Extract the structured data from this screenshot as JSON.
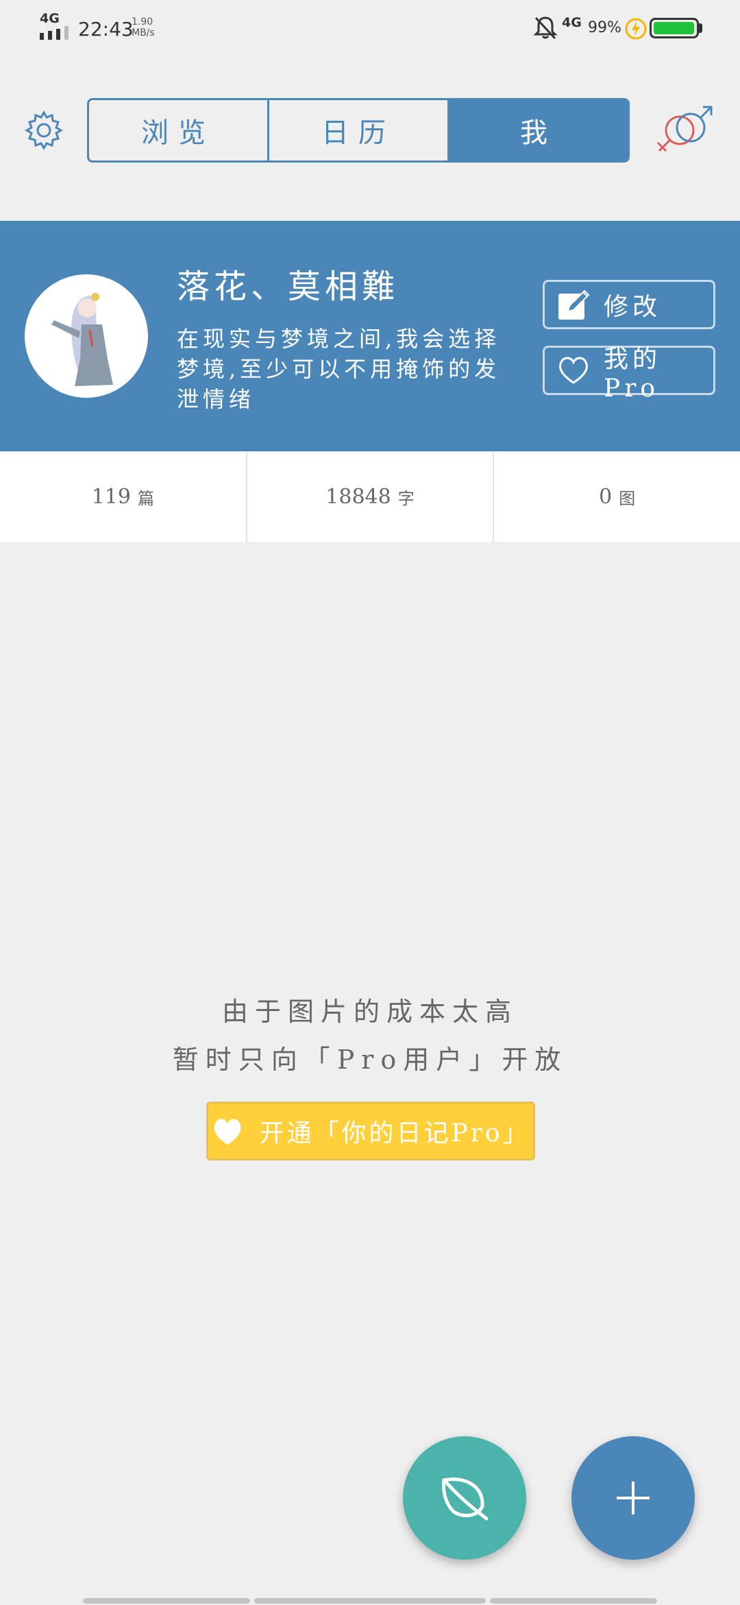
{
  "status_bar": {
    "network": "4G",
    "time": "22:43",
    "speed_value": "1.90",
    "speed_unit": "MB/s",
    "network2": "4G",
    "battery_pct": "99%",
    "battery_level": 0.99
  },
  "top_bar": {
    "tabs": [
      {
        "label": "浏览",
        "active": false
      },
      {
        "label": "日历",
        "active": false
      },
      {
        "label": "我",
        "active": true
      }
    ]
  },
  "profile": {
    "username": "落花、莫相難",
    "bio": "在现实与梦境之间,我会选择梦境,至少可以不用掩饰的发泄情绪",
    "edit_label": "修改",
    "pro_label": "我的Pro"
  },
  "stats": [
    {
      "value": "119",
      "unit": "篇"
    },
    {
      "value": "18848",
      "unit": "字"
    },
    {
      "value": "0",
      "unit": "图"
    }
  ],
  "message": {
    "line1": "由于图片的成本太高",
    "line2": "暂时只向「Pro用户」开放",
    "button": "开通「你的日记Pro」"
  },
  "colors": {
    "primary": "#4a87b8",
    "teal": "#4cb3aa",
    "pro_yellow": "#ffd03a",
    "battery_green": "#21c23a",
    "background": "#efefef"
  }
}
